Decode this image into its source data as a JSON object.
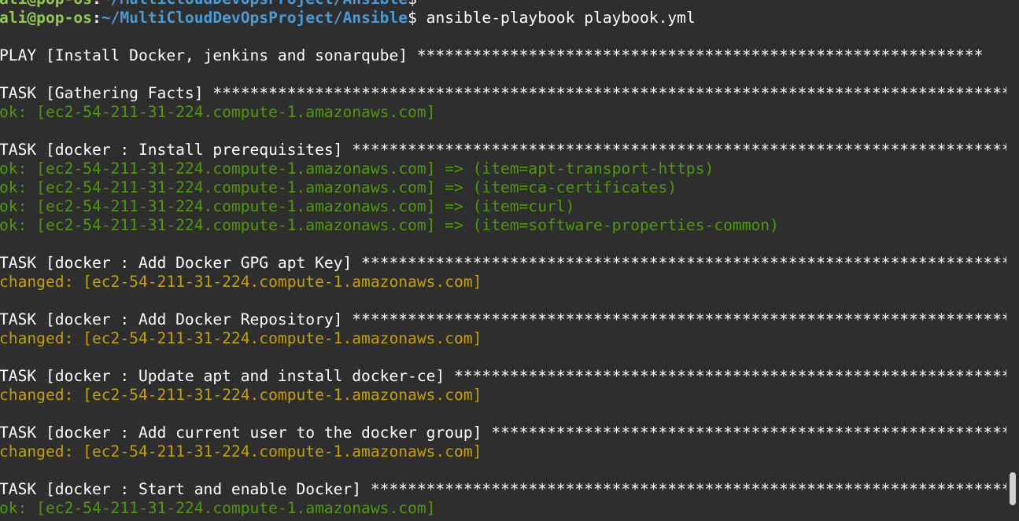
{
  "terminal": {
    "prompt": {
      "user_host": "ali@pop-os",
      "separator": ":",
      "path": "~/MultiCloudDevOpsProject/Ansible",
      "symbol": "$",
      "command": " ansible-playbook playbook.yml"
    },
    "lines": [
      {
        "kind": "play",
        "text": "PLAY [Install Docker, jenkins and sonarqube] ",
        "stars": "*************************************************************"
      },
      {
        "kind": "blank"
      },
      {
        "kind": "task",
        "text": "TASK [Gathering Facts] ",
        "stars": "****************************************************************************************"
      },
      {
        "kind": "ok",
        "text": "ok: [ec2-54-211-31-224.compute-1.amazonaws.com]"
      },
      {
        "kind": "blank"
      },
      {
        "kind": "task",
        "text": "TASK [docker : Install prerequisites] ",
        "stars": "***************************************************************************"
      },
      {
        "kind": "ok",
        "text": "ok: [ec2-54-211-31-224.compute-1.amazonaws.com] => (item=apt-transport-https)"
      },
      {
        "kind": "ok",
        "text": "ok: [ec2-54-211-31-224.compute-1.amazonaws.com] => (item=ca-certificates)"
      },
      {
        "kind": "ok",
        "text": "ok: [ec2-54-211-31-224.compute-1.amazonaws.com] => (item=curl)"
      },
      {
        "kind": "ok",
        "text": "ok: [ec2-54-211-31-224.compute-1.amazonaws.com] => (item=software-properties-common)"
      },
      {
        "kind": "blank"
      },
      {
        "kind": "task",
        "text": "TASK [docker : Add Docker GPG apt Key] ",
        "stars": "**************************************************************************"
      },
      {
        "kind": "changed",
        "text": "changed: [ec2-54-211-31-224.compute-1.amazonaws.com]"
      },
      {
        "kind": "blank"
      },
      {
        "kind": "task",
        "text": "TASK [docker : Add Docker Repository] ",
        "stars": "***************************************************************************"
      },
      {
        "kind": "changed",
        "text": "changed: [ec2-54-211-31-224.compute-1.amazonaws.com]"
      },
      {
        "kind": "blank"
      },
      {
        "kind": "task",
        "text": "TASK [docker : Update apt and install docker-ce] ",
        "stars": "****************************************************************"
      },
      {
        "kind": "changed",
        "text": "changed: [ec2-54-211-31-224.compute-1.amazonaws.com]"
      },
      {
        "kind": "blank"
      },
      {
        "kind": "task",
        "text": "TASK [docker : Add current user to the docker group] ",
        "stars": "************************************************************"
      },
      {
        "kind": "changed",
        "text": "changed: [ec2-54-211-31-224.compute-1.amazonaws.com]"
      },
      {
        "kind": "blank"
      },
      {
        "kind": "task",
        "text": "TASK [docker : Start and enable Docker] ",
        "stars": "*************************************************************************"
      },
      {
        "kind": "ok",
        "text": "ok: [ec2-54-211-31-224.compute-1.amazonaws.com]"
      }
    ]
  },
  "colors": {
    "background": "#2e2e2e",
    "prompt_user": "#94c94a",
    "prompt_path": "#4a9ad4",
    "ok": "#4e9a06",
    "changed": "#c4a000",
    "text": "#ffffff"
  },
  "scrollbar": {
    "position_fraction": 0.95
  }
}
